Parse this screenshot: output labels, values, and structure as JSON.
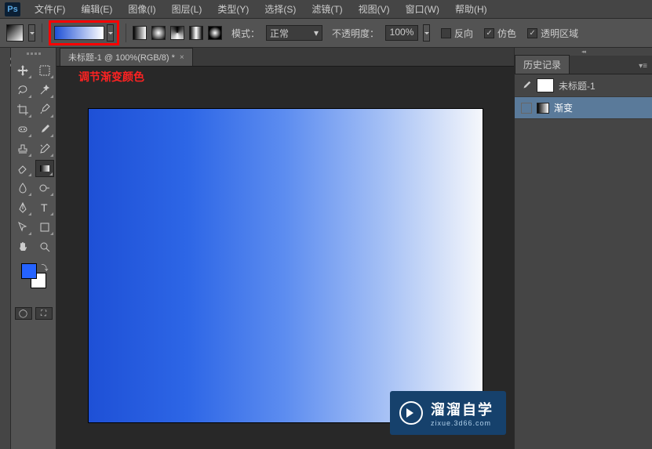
{
  "menu": {
    "items": [
      "文件(F)",
      "编辑(E)",
      "图像(I)",
      "图层(L)",
      "类型(Y)",
      "选择(S)",
      "滤镜(T)",
      "视图(V)",
      "窗口(W)",
      "帮助(H)"
    ]
  },
  "options": {
    "mode_label": "模式：",
    "mode_value": "正常",
    "opacity_label": "不透明度：",
    "opacity_value": "100%",
    "reverse_label": "反向",
    "dither_label": "仿色",
    "transparency_label": "透明区域"
  },
  "document": {
    "tab_title": "未标题-1 @ 100%(RGB/8) *"
  },
  "annotation": "调节渐变颜色",
  "panels": {
    "history_tab": "历史记录",
    "entries": [
      {
        "label": "未标题-1"
      },
      {
        "label": "渐变"
      }
    ]
  },
  "watermark": {
    "title": "溜溜自学",
    "sub": "zixue.3d66.com"
  },
  "colors": {
    "foreground": "#2563ff",
    "background": "#ffffff"
  }
}
